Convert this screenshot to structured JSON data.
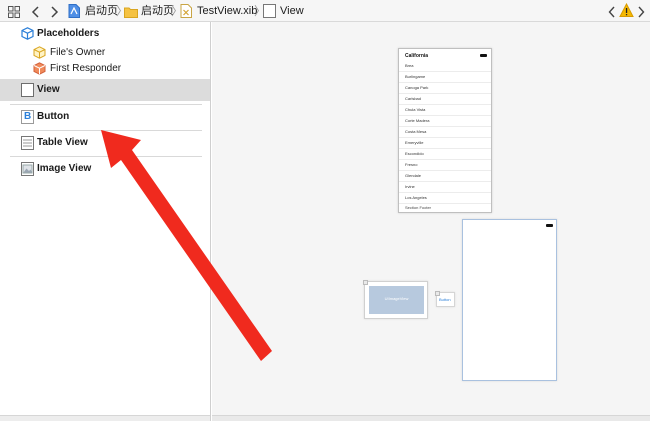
{
  "breadcrumb": {
    "items": [
      {
        "label": "启动页",
        "icon": "project-icon"
      },
      {
        "label": "启动页",
        "icon": "folder-icon"
      },
      {
        "label": "TestView.xib",
        "icon": "xib-file-icon"
      },
      {
        "label": "View",
        "icon": "view-icon"
      }
    ]
  },
  "outline": {
    "placeholders_title": "Placeholders",
    "placeholders": [
      {
        "label": "File's Owner",
        "icon": "files-owner-icon"
      },
      {
        "label": "First Responder",
        "icon": "first-responder-icon"
      }
    ],
    "objects": [
      {
        "label": "View",
        "icon": "view-icon",
        "selected": true
      },
      {
        "label": "Button",
        "icon": "button-icon",
        "glyph": "B",
        "selected": false
      },
      {
        "label": "Table View",
        "icon": "table-view-icon",
        "selected": false
      },
      {
        "label": "Image View",
        "icon": "image-view-icon",
        "selected": false
      }
    ]
  },
  "canvas": {
    "table_view": {
      "header": "California",
      "rows": [
        "Brea",
        "Burlingame",
        "Canoga Park",
        "Carlsbad",
        "Chula Vista",
        "Corte Madera",
        "Costa Mesa",
        "Emeryville",
        "Escondido",
        "Fresno",
        "Glendale",
        "Irvine",
        "Los Angeles"
      ],
      "footer": "Section Footer"
    },
    "image_view_label": "UIImageView",
    "button_label": "Button"
  },
  "colors": {
    "accent": "#3b82f6",
    "warning": "#f5b800",
    "arrow": "#f02a1e",
    "selected_row": "#dcdcdc",
    "image_placeholder": "#b7c9de"
  }
}
